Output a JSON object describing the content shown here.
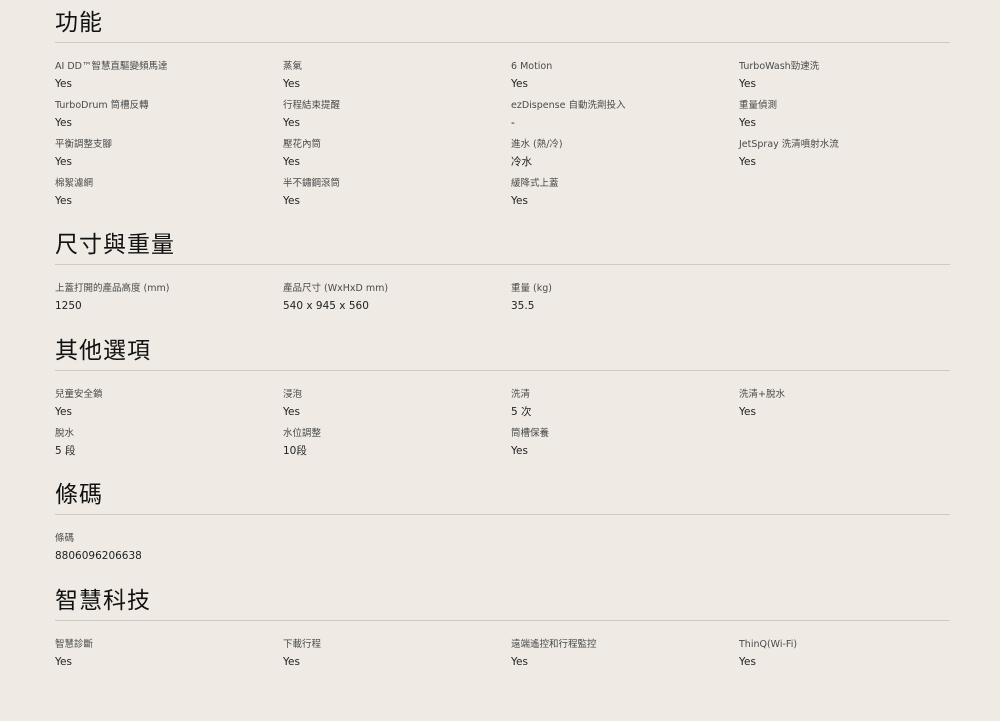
{
  "sections": [
    {
      "title": "功能",
      "items": [
        {
          "label": "AI DD™智慧直驅變頻馬達",
          "value": "Yes"
        },
        {
          "label": "蒸氣",
          "value": "Yes"
        },
        {
          "label": "6 Motion",
          "value": "Yes"
        },
        {
          "label": "TurboWash勁速洗",
          "value": "Yes"
        },
        {
          "label": "TurboDrum 筒槽反轉",
          "value": "Yes"
        },
        {
          "label": "行程結束提醒",
          "value": "Yes"
        },
        {
          "label": "ezDispense 自動洗劑投入",
          "value": "-"
        },
        {
          "label": "重量偵測",
          "value": "Yes"
        },
        {
          "label": "平衡調整支腳",
          "value": "Yes"
        },
        {
          "label": "壓花內筒",
          "value": "Yes"
        },
        {
          "label": "進水 (熱/冷)",
          "value": "冷水"
        },
        {
          "label": "JetSpray 洗清噴射水流",
          "value": "Yes"
        },
        {
          "label": "棉絮濾網",
          "value": "Yes"
        },
        {
          "label": "半不鏽鋼滾筒",
          "value": "Yes"
        },
        {
          "label": "緩降式上蓋",
          "value": "Yes"
        }
      ]
    },
    {
      "title": "尺寸與重量",
      "items": [
        {
          "label": "上蓋打開的產品高度 (mm)",
          "value": "1250"
        },
        {
          "label": "產品尺寸 (WxHxD mm)",
          "value": "540 x 945 x 560"
        },
        {
          "label": "重量 (kg)",
          "value": "35.5"
        }
      ]
    },
    {
      "title": "其他選項",
      "items": [
        {
          "label": "兒童安全鎖",
          "value": "Yes"
        },
        {
          "label": "浸泡",
          "value": "Yes"
        },
        {
          "label": "洗清",
          "value": "5 次"
        },
        {
          "label": "洗清+脫水",
          "value": "Yes"
        },
        {
          "label": "脫水",
          "value": "5 段"
        },
        {
          "label": "水位調整",
          "value": "10段"
        },
        {
          "label": "筒槽保養",
          "value": "Yes"
        }
      ]
    },
    {
      "title": "條碼",
      "items": [
        {
          "label": "條碼",
          "value": "8806096206638"
        }
      ]
    },
    {
      "title": "智慧科技",
      "items": [
        {
          "label": "智慧診斷",
          "value": "Yes"
        },
        {
          "label": "下載行程",
          "value": "Yes"
        },
        {
          "label": "遠端遙控和行程監控",
          "value": "Yes"
        },
        {
          "label": "ThinQ(Wi-Fi)",
          "value": "Yes"
        }
      ]
    }
  ]
}
